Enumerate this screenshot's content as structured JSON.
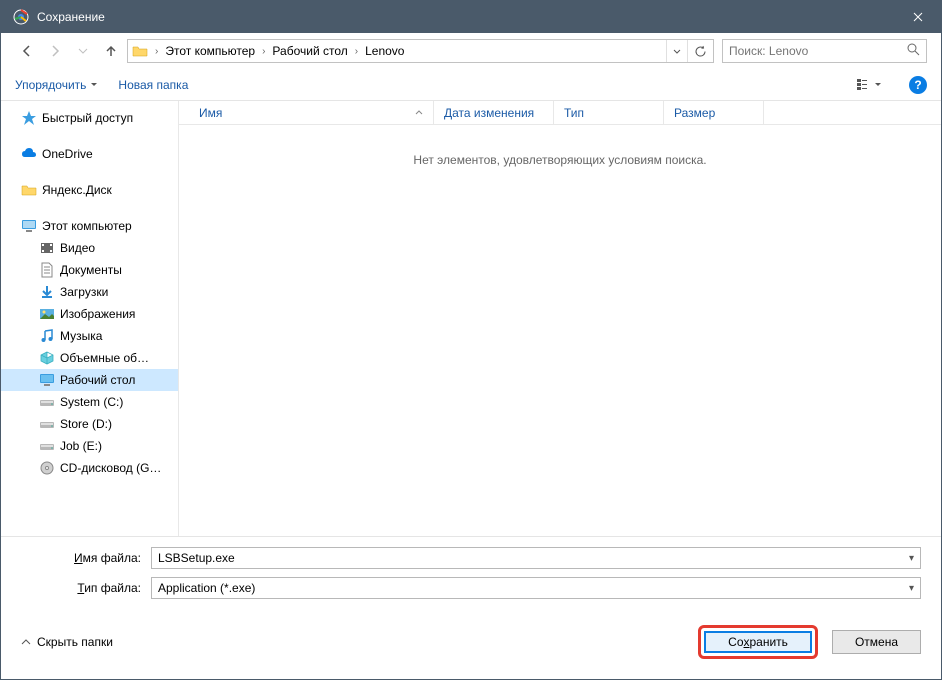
{
  "titlebar": {
    "title": "Сохранение"
  },
  "breadcrumb": {
    "items": [
      "Этот компьютер",
      "Рабочий стол",
      "Lenovo"
    ]
  },
  "search": {
    "placeholder": "Поиск: Lenovo"
  },
  "toolbar": {
    "organize": "Упорядочить",
    "newFolder": "Новая папка"
  },
  "sidebar": {
    "quickAccess": "Быстрый доступ",
    "oneDrive": "OneDrive",
    "yandexDisk": "Яндекс.Диск",
    "thisPc": "Этот компьютер",
    "videos": "Видео",
    "documents": "Документы",
    "downloads": "Загрузки",
    "pictures": "Изображения",
    "music": "Музыка",
    "volumes": "Объемные об…",
    "desktop": "Рабочий стол",
    "systemC": "System (C:)",
    "storeD": "Store (D:)",
    "jobE": "Job (E:)",
    "cdG": "CD-дисковод (G…"
  },
  "columns": {
    "name": "Имя",
    "date": "Дата изменения",
    "type": "Тип",
    "size": "Размер"
  },
  "empty": "Нет элементов, удовлетворяющих условиям поиска.",
  "fields": {
    "filenameLabelPrefix": "И",
    "filenameLabelRest": "мя файла:",
    "filetypeLabelPrefix": "Т",
    "filetypeLabelRest": "ип файла:",
    "filename": "LSBSetup.exe",
    "filetype": "Application (*.exe)"
  },
  "footer": {
    "hideFolders": "Скрыть папки",
    "savePrefix": "Со",
    "saveUnderline": "х",
    "saveRest": "ранить",
    "cancel": "Отмена"
  }
}
